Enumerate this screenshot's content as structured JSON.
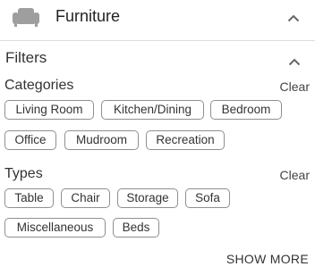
{
  "panel": {
    "title": "Furniture",
    "icon": "sofa-icon"
  },
  "filters": {
    "title": "Filters",
    "categories": {
      "title": "Categories",
      "clear_label": "Clear",
      "chips": [
        "Living Room",
        "Kitchen/Dining",
        "Bedroom",
        "Office",
        "Mudroom",
        "Recreation"
      ]
    },
    "types": {
      "title": "Types",
      "clear_label": "Clear",
      "chips": [
        "Table",
        "Chair",
        "Storage",
        "Sofa",
        "Miscellaneous",
        "Beds"
      ]
    },
    "show_more_label": "SHOW MORE"
  },
  "colors": {
    "icon_gray": "#9e9e9e",
    "chip_border": "#8f8f8f",
    "divider": "#dddddd"
  }
}
